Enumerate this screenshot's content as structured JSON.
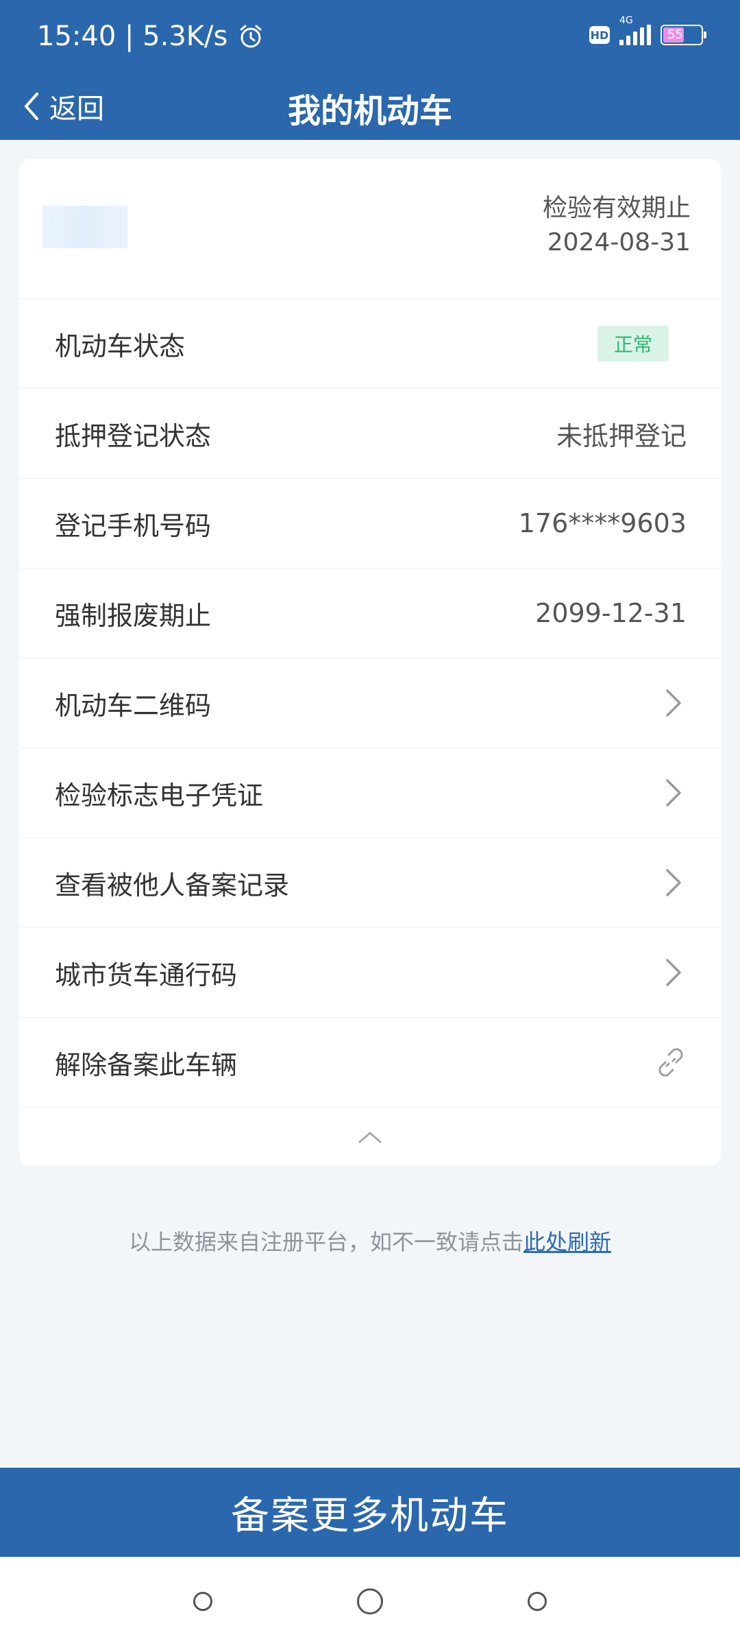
{
  "status_bar": {
    "time_speed": "15:40 | 5.3K/s",
    "hd": "HD",
    "network": "4G",
    "battery": "55",
    "battery_level": 0.55
  },
  "nav": {
    "back_label": "返回",
    "title": "我的机动车"
  },
  "card": {
    "inspection_label": "检验有效期止",
    "inspection_date": "2024-08-31",
    "rows": {
      "vehicle_status": {
        "label": "机动车状态",
        "tag": "正常"
      },
      "mortgage": {
        "label": "抵押登记状态",
        "value": "未抵押登记"
      },
      "phone": {
        "label": "登记手机号码",
        "value": "176****9603"
      },
      "scrap": {
        "label": "强制报废期止",
        "value": "2099-12-31"
      },
      "qr_code": {
        "label": "机动车二维码"
      },
      "inspection_cert": {
        "label": "检验标志电子凭证"
      },
      "filing_records": {
        "label": "查看被他人备案记录"
      },
      "truck_pass": {
        "label": "城市货车通行码"
      },
      "unfile": {
        "label": "解除备案此车辆"
      }
    }
  },
  "footer_note": {
    "text": "以上数据来自注册平台，如不一致请点击",
    "link": "此处刷新"
  },
  "bottom_button": "备案更多机动车",
  "colors": {
    "primary": "#2b67ac",
    "tag_bg": "#d9f3e6",
    "tag_text": "#2eb773",
    "link": "#2b6bb5"
  }
}
